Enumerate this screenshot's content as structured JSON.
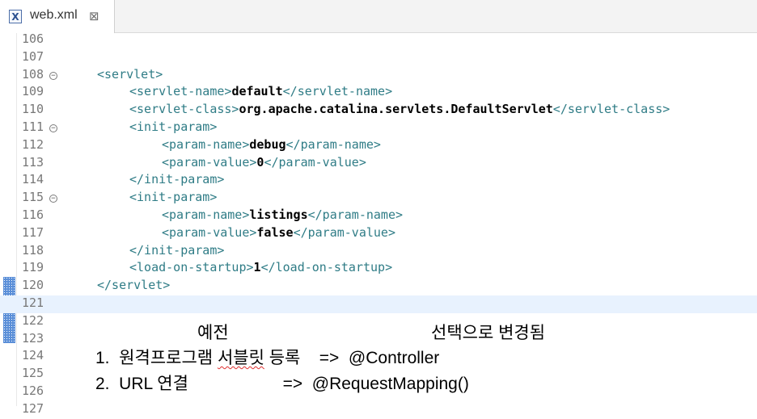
{
  "tab": {
    "title": "web.xml",
    "icon": "xml-file-icon",
    "close": "close-icon"
  },
  "editor": {
    "lines": [
      {
        "num": "106",
        "indent": 0,
        "parts": []
      },
      {
        "num": "107",
        "indent": 0,
        "parts": []
      },
      {
        "num": "108",
        "fold": true,
        "indent": 1,
        "parts": [
          {
            "t": "tag",
            "v": "<servlet>"
          }
        ]
      },
      {
        "num": "109",
        "indent": 2,
        "parts": [
          {
            "t": "tag",
            "v": "<servlet-name>"
          },
          {
            "t": "txt",
            "v": "default"
          },
          {
            "t": "tag",
            "v": "</servlet-name>"
          }
        ]
      },
      {
        "num": "110",
        "indent": 2,
        "parts": [
          {
            "t": "tag",
            "v": "<servlet-class>"
          },
          {
            "t": "txt",
            "v": "org.apache.catalina.servlets.DefaultServlet"
          },
          {
            "t": "tag",
            "v": "</servlet-class>"
          }
        ]
      },
      {
        "num": "111",
        "fold": true,
        "indent": 2,
        "parts": [
          {
            "t": "tag",
            "v": "<init-param>"
          }
        ]
      },
      {
        "num": "112",
        "indent": 3,
        "parts": [
          {
            "t": "tag",
            "v": "<param-name>"
          },
          {
            "t": "txt",
            "v": "debug"
          },
          {
            "t": "tag",
            "v": "</param-name>"
          }
        ]
      },
      {
        "num": "113",
        "indent": 3,
        "parts": [
          {
            "t": "tag",
            "v": "<param-value>"
          },
          {
            "t": "txt",
            "v": "0"
          },
          {
            "t": "tag",
            "v": "</param-value>"
          }
        ]
      },
      {
        "num": "114",
        "indent": 2,
        "parts": [
          {
            "t": "tag",
            "v": "</init-param>"
          }
        ]
      },
      {
        "num": "115",
        "fold": true,
        "indent": 2,
        "parts": [
          {
            "t": "tag",
            "v": "<init-param>"
          }
        ]
      },
      {
        "num": "116",
        "indent": 3,
        "parts": [
          {
            "t": "tag",
            "v": "<param-name>"
          },
          {
            "t": "txt",
            "v": "listings"
          },
          {
            "t": "tag",
            "v": "</param-name>"
          }
        ]
      },
      {
        "num": "117",
        "indent": 3,
        "parts": [
          {
            "t": "tag",
            "v": "<param-value>"
          },
          {
            "t": "txt",
            "v": "false"
          },
          {
            "t": "tag",
            "v": "</param-value>"
          }
        ]
      },
      {
        "num": "118",
        "indent": 2,
        "parts": [
          {
            "t": "tag",
            "v": "</init-param>"
          }
        ]
      },
      {
        "num": "119",
        "indent": 2,
        "parts": [
          {
            "t": "tag",
            "v": "<load-on-startup>"
          },
          {
            "t": "txt",
            "v": "1"
          },
          {
            "t": "tag",
            "v": "</load-on-startup>"
          }
        ]
      },
      {
        "num": "120",
        "indent": 1,
        "parts": [
          {
            "t": "tag",
            "v": "</servlet>"
          }
        ]
      },
      {
        "num": "121",
        "indent": 0,
        "current": true,
        "parts": []
      },
      {
        "num": "122",
        "indent": 0,
        "parts": []
      },
      {
        "num": "123",
        "indent": 0,
        "parts": []
      },
      {
        "num": "124",
        "indent": 0,
        "parts": []
      },
      {
        "num": "125",
        "indent": 0,
        "parts": []
      },
      {
        "num": "126",
        "indent": 0,
        "parts": []
      },
      {
        "num": "127",
        "indent": 0,
        "parts": []
      }
    ]
  },
  "notes": {
    "heading_left": "예전",
    "heading_right": "선택으로 변경됨",
    "item1_prefix": "1.  원격프로그램 ",
    "item1_squiggle": "서블릿",
    "item1_rest": " 등록    =>  @Controller",
    "item2": "2.  URL 연결                    =>  @RequestMapping()"
  }
}
